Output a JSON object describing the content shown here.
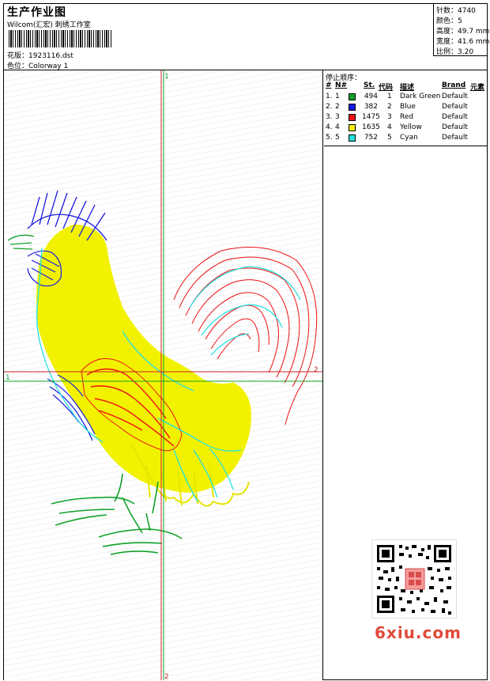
{
  "header": {
    "title": "生产作业图",
    "subtitle": "Wilcom(汇宏) 刺绣工作室",
    "design_label": "花版：",
    "design_file": "1923116.dst",
    "colorway_label": "色位：",
    "colorway": "Colorway 1"
  },
  "stats": {
    "stitches": "针数：4740",
    "colors": "颜色：5",
    "height": "高度：49.7 mm",
    "width": "宽度：41.6 mm",
    "scale": "比例：3.20"
  },
  "panel": {
    "stop_sequence_label": "停止顺序：",
    "headers": [
      "#",
      "N#",
      "St.",
      "代码",
      "描述",
      "Brand",
      "元素"
    ],
    "rows": [
      {
        "idx": "1.",
        "n": "1",
        "color": "#12a12a",
        "st": "494",
        "code": "1",
        "desc": "Dark Green",
        "brand": "Default"
      },
      {
        "idx": "2.",
        "n": "2",
        "color": "#1a1ae0",
        "st": "382",
        "code": "2",
        "desc": "Blue",
        "brand": "Default"
      },
      {
        "idx": "3.",
        "n": "3",
        "color": "#ee1111",
        "st": "1475",
        "code": "3",
        "desc": "Red",
        "brand": "Default"
      },
      {
        "idx": "4.",
        "n": "4",
        "color": "#f2f200",
        "st": "1635",
        "code": "4",
        "desc": "Yellow",
        "brand": "Default"
      },
      {
        "idx": "5.",
        "n": "5",
        "color": "#22e0e0",
        "st": "752",
        "code": "5",
        "desc": "Cyan",
        "brand": "Default"
      }
    ]
  },
  "axes": {
    "v_top": "1",
    "v_bottom": "2",
    "h_left": "1",
    "h_right": "2"
  },
  "colors": {
    "dark_green": "#12a12a",
    "blue": "#1a1ae0",
    "red": "#ee1111",
    "yellow": "#f2f200",
    "cyan": "#22e0e0"
  },
  "watermark": "6xiu.com"
}
